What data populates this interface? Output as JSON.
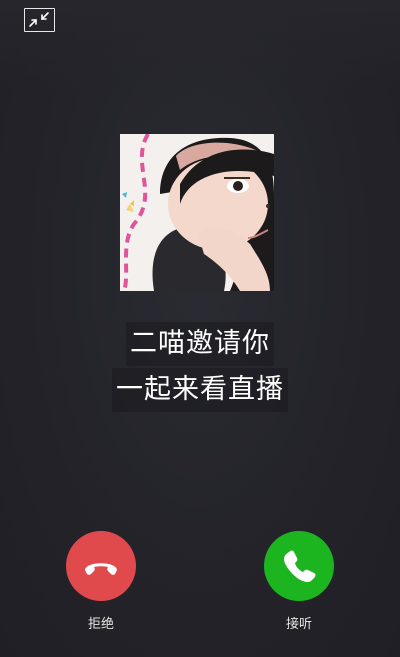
{
  "call": {
    "message_line1": "二喵邀请你",
    "message_line2": "一起来看直播"
  },
  "actions": {
    "decline_label": "拒绝",
    "accept_label": "接听"
  },
  "icons": {
    "minimize": "minimize-window-icon",
    "decline": "hang-up-phone-icon",
    "accept": "phone-icon"
  },
  "colors": {
    "background": "#232329",
    "decline": "#e04a4c",
    "accept": "#1cb41f"
  }
}
